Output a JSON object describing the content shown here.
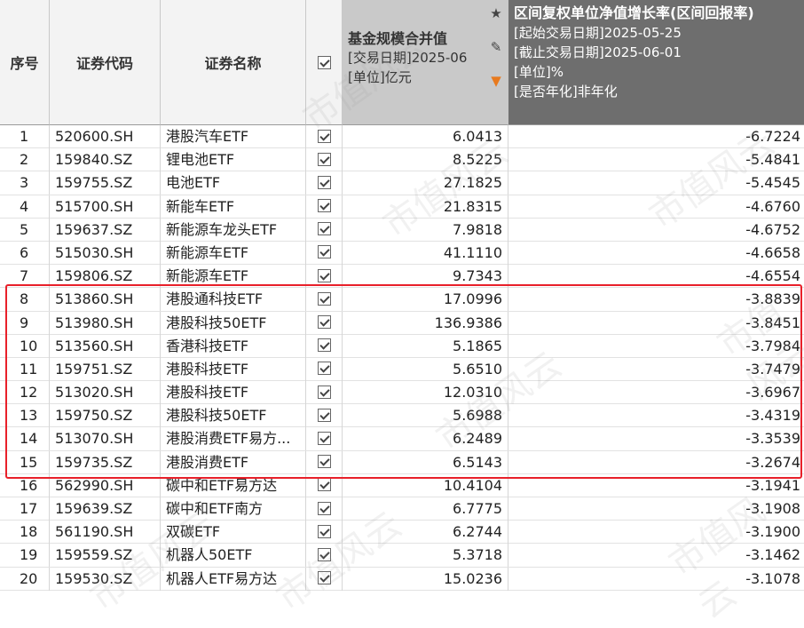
{
  "headers": {
    "index": "序号",
    "code": "证券代码",
    "name": "证券名称",
    "fund_size": {
      "title": "基金规模合并值",
      "line2": "[交易日期]2025-06",
      "line3": "[单位]亿元"
    },
    "return": {
      "title": "区间复权单位净值增长率(区间回报率)",
      "line2": "[起始交易日期]2025-05-25",
      "line3": "[截止交易日期]2025-06-01",
      "line4": "[单位]%",
      "line5": "[是否年化]非年化"
    },
    "icons": [
      "star-icon",
      "pencil-icon",
      "filter-icon"
    ]
  },
  "watermark": "市值风云",
  "rows": [
    {
      "index": "1",
      "code": "520600.SH",
      "name": "港股汽车ETF",
      "size": "6.0413",
      "ret": "-6.7224"
    },
    {
      "index": "2",
      "code": "159840.SZ",
      "name": "锂电池ETF",
      "size": "8.5225",
      "ret": "-5.4841"
    },
    {
      "index": "3",
      "code": "159755.SZ",
      "name": "电池ETF",
      "size": "27.1825",
      "ret": "-5.4545"
    },
    {
      "index": "4",
      "code": "515700.SH",
      "name": "新能车ETF",
      "size": "21.8315",
      "ret": "-4.6760"
    },
    {
      "index": "5",
      "code": "159637.SZ",
      "name": "新能源车龙头ETF",
      "size": "7.9818",
      "ret": "-4.6752"
    },
    {
      "index": "6",
      "code": "515030.SH",
      "name": "新能源车ETF",
      "size": "41.1110",
      "ret": "-4.6658"
    },
    {
      "index": "7",
      "code": "159806.SZ",
      "name": "新能源车ETF",
      "size": "9.7343",
      "ret": "-4.6554"
    },
    {
      "index": "8",
      "code": "513860.SH",
      "name": "港股通科技ETF",
      "size": "17.0996",
      "ret": "-3.8839"
    },
    {
      "index": "9",
      "code": "513980.SH",
      "name": "港股科技50ETF",
      "size": "136.9386",
      "ret": "-3.8451"
    },
    {
      "index": "10",
      "code": "513560.SH",
      "name": "香港科技ETF",
      "size": "5.1865",
      "ret": "-3.7984"
    },
    {
      "index": "11",
      "code": "159751.SZ",
      "name": "港股科技ETF",
      "size": "5.6510",
      "ret": "-3.7479"
    },
    {
      "index": "12",
      "code": "513020.SH",
      "name": "港股科技ETF",
      "size": "12.0310",
      "ret": "-3.6967"
    },
    {
      "index": "13",
      "code": "159750.SZ",
      "name": "港股科技50ETF",
      "size": "5.6988",
      "ret": "-3.4319"
    },
    {
      "index": "14",
      "code": "513070.SH",
      "name": "港股消费ETF易方...",
      "size": "6.2489",
      "ret": "-3.3539"
    },
    {
      "index": "15",
      "code": "159735.SZ",
      "name": "港股消费ETF",
      "size": "6.5143",
      "ret": "-3.2674"
    },
    {
      "index": "16",
      "code": "562990.SH",
      "name": "碳中和ETF易方达",
      "size": "10.4104",
      "ret": "-3.1941"
    },
    {
      "index": "17",
      "code": "159639.SZ",
      "name": "碳中和ETF南方",
      "size": "6.7775",
      "ret": "-3.1908"
    },
    {
      "index": "18",
      "code": "561190.SH",
      "name": "双碳ETF",
      "size": "6.2744",
      "ret": "-3.1900"
    },
    {
      "index": "19",
      "code": "159559.SZ",
      "name": "机器人50ETF",
      "size": "5.3718",
      "ret": "-3.1462"
    },
    {
      "index": "20",
      "code": "159530.SZ",
      "name": "机器人ETF易方达",
      "size": "15.0236",
      "ret": "-3.1078"
    }
  ],
  "highlight": {
    "from_index": "8",
    "to_index": "15",
    "color": "#e8202a"
  }
}
